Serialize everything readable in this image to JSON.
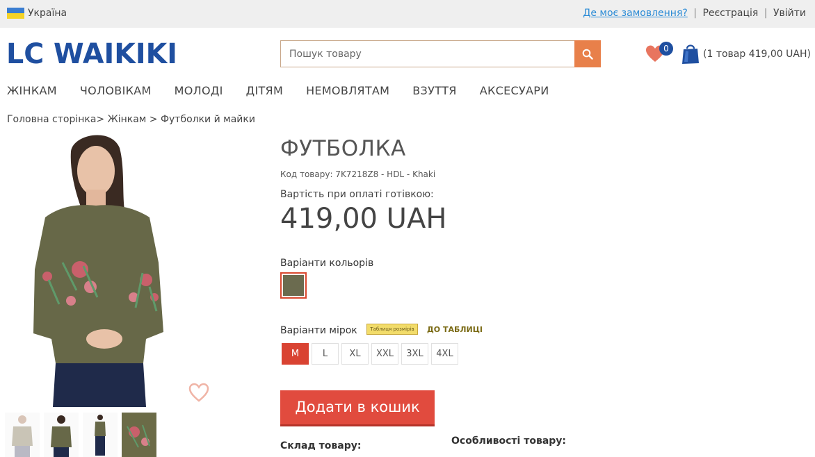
{
  "topbar": {
    "country": "Україна",
    "order_link": "Де моє замовлення?",
    "separator": "|",
    "register": "Реєстрація",
    "login": "Увійти"
  },
  "header": {
    "logo_text": "LC WAIKIKI",
    "search": {
      "placeholder": "Пошук товару",
      "value": ""
    },
    "wishlist_count": "0",
    "cart_summary": "(1 товар 419,00 UAH)"
  },
  "nav": {
    "items": [
      {
        "label": "ЖІНКАМ"
      },
      {
        "label": "ЧОЛОВІКАМ"
      },
      {
        "label": "МОЛОДІ"
      },
      {
        "label": "ДІТЯМ"
      },
      {
        "label": "НЕМОВЛЯТАМ"
      },
      {
        "label": "ВЗУТТЯ"
      },
      {
        "label": "АКСЕСУАРИ"
      }
    ]
  },
  "breadcrumb": "Головна сторінка> Жінкам > Футболки й майки",
  "product": {
    "title": "ФУТБОЛКА",
    "code": "Код товару: 7K7218Z8 - HDL - Khaki",
    "price_label": "Вартість при оплаті готівкою:",
    "price": "419,00 UAH",
    "colors_label": "Варіанти кольорів",
    "selected_color": "#6b6b4f",
    "sizes_label": "Варіанти мірок",
    "size_chart_badge": "Таблиця розмірів",
    "size_chart_link": "ДО ТАБЛИЦІ",
    "sizes": [
      {
        "label": "M",
        "selected": true
      },
      {
        "label": "L",
        "selected": false
      },
      {
        "label": "XL",
        "selected": false
      },
      {
        "label": "XXL",
        "selected": false
      },
      {
        "label": "3XL",
        "selected": false
      },
      {
        "label": "4XL",
        "selected": false
      }
    ],
    "add_to_cart": "Додати в кошик",
    "composition_label": "Склад товару:",
    "features_label": "Особливості товару:"
  },
  "colors": {
    "brand_blue": "#1f4fa0",
    "accent_orange": "#e8804a",
    "accent_red": "#e14b3e",
    "khaki": "#6b6b47"
  }
}
